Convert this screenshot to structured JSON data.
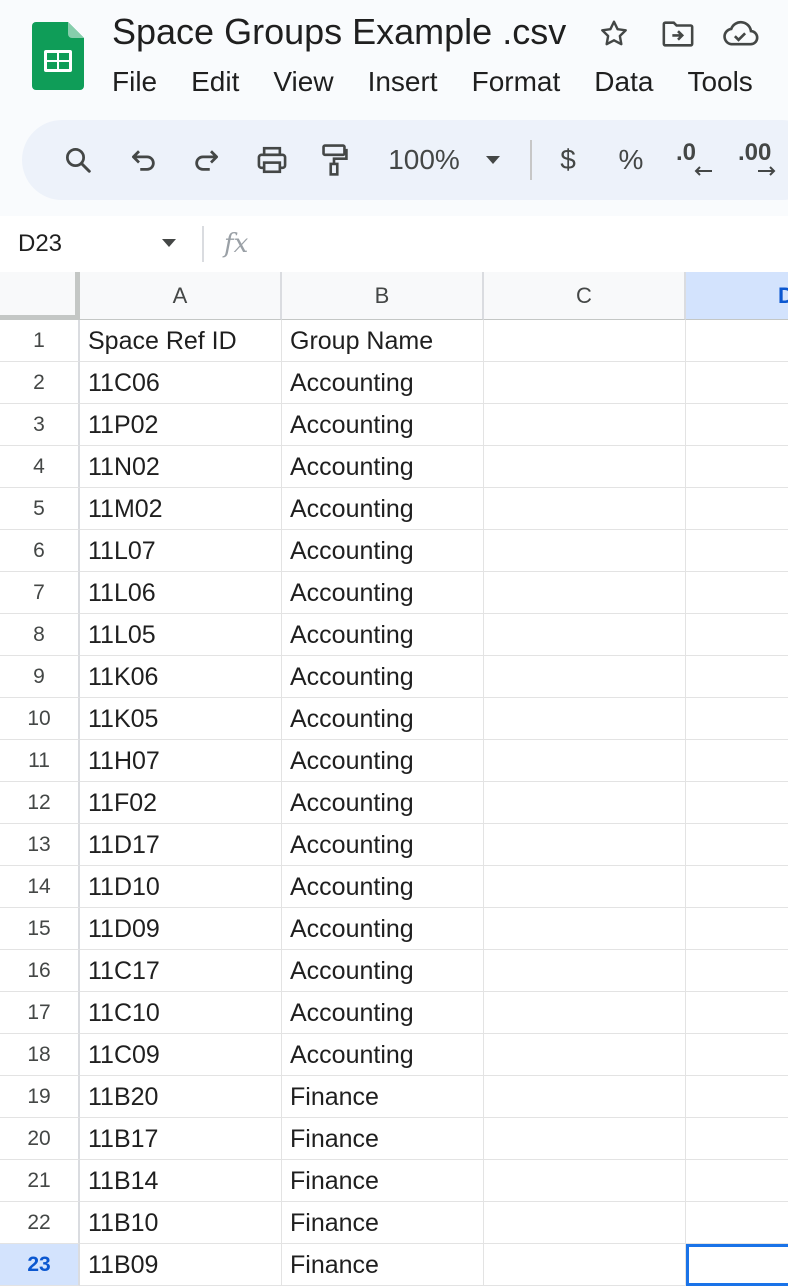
{
  "document": {
    "title": "Space Groups Example .csv"
  },
  "menu": [
    "File",
    "Edit",
    "View",
    "Insert",
    "Format",
    "Data",
    "Tools"
  ],
  "toolbar": {
    "zoom": "100%",
    "currency_symbol": "$",
    "percent_symbol": "%",
    "decrease_decimal": ".0",
    "increase_decimal": ".00",
    "icons": [
      "search-icon",
      "undo-icon",
      "redo-icon",
      "print-icon",
      "paint-format-icon",
      "dropdown-icon"
    ]
  },
  "formula_bar": {
    "name_box": "D23",
    "fx_label": "fx",
    "value": ""
  },
  "grid": {
    "columns": [
      "A",
      "B",
      "C",
      "D"
    ],
    "selected_column": "D",
    "selected_row": "23",
    "active_cell": "D23",
    "rows": [
      {
        "n": "1",
        "a": "Space Ref ID",
        "b": "Group Name"
      },
      {
        "n": "2",
        "a": "11C06",
        "b": "Accounting"
      },
      {
        "n": "3",
        "a": "11P02",
        "b": "Accounting"
      },
      {
        "n": "4",
        "a": "11N02",
        "b": "Accounting"
      },
      {
        "n": "5",
        "a": "11M02",
        "b": "Accounting"
      },
      {
        "n": "6",
        "a": "11L07",
        "b": "Accounting"
      },
      {
        "n": "7",
        "a": "11L06",
        "b": "Accounting"
      },
      {
        "n": "8",
        "a": "11L05",
        "b": "Accounting"
      },
      {
        "n": "9",
        "a": "11K06",
        "b": "Accounting"
      },
      {
        "n": "10",
        "a": "11K05",
        "b": "Accounting"
      },
      {
        "n": "11",
        "a": "11H07",
        "b": "Accounting"
      },
      {
        "n": "12",
        "a": "11F02",
        "b": "Accounting"
      },
      {
        "n": "13",
        "a": "11D17",
        "b": "Accounting"
      },
      {
        "n": "14",
        "a": "11D10",
        "b": "Accounting"
      },
      {
        "n": "15",
        "a": "11D09",
        "b": "Accounting"
      },
      {
        "n": "16",
        "a": "11C17",
        "b": "Accounting"
      },
      {
        "n": "17",
        "a": "11C10",
        "b": "Accounting"
      },
      {
        "n": "18",
        "a": "11C09",
        "b": "Accounting"
      },
      {
        "n": "19",
        "a": "11B20",
        "b": "Finance"
      },
      {
        "n": "20",
        "a": "11B17",
        "b": "Finance"
      },
      {
        "n": "21",
        "a": "11B14",
        "b": "Finance"
      },
      {
        "n": "22",
        "a": "11B10",
        "b": "Finance"
      },
      {
        "n": "23",
        "a": "11B09",
        "b": "Finance"
      }
    ]
  },
  "colors": {
    "accent": "#1a73e8",
    "selection_fill": "#d3e3fd",
    "toolbar_bg": "#edf2fa",
    "sheets_green": "#0f9d58"
  }
}
